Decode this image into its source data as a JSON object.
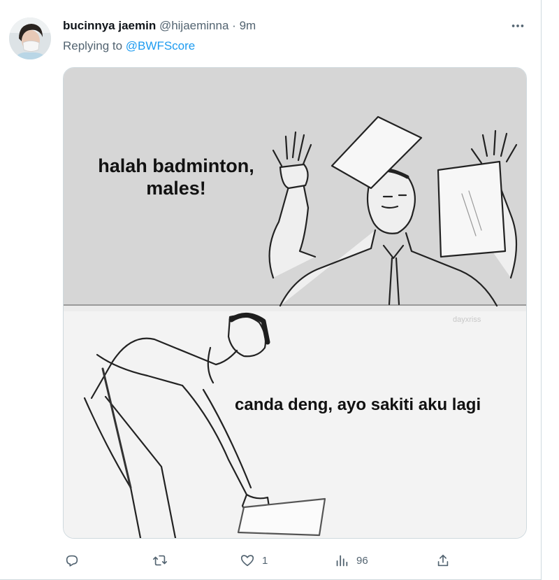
{
  "tweet": {
    "display_name": "bucinnya jaemin",
    "handle": "@hijaeminna",
    "separator": "·",
    "time": "9m",
    "replying_label": "Replying to",
    "replying_to": "@BWFScore"
  },
  "meme": {
    "top_caption": "halah badminton, males!",
    "bottom_caption": "canda deng, ayo sakiti aku lagi",
    "watermark": "dayxriss"
  },
  "actions": {
    "reply_count": "",
    "retweet_count": "",
    "like_count": "1",
    "views_count": "96"
  },
  "icons": {
    "more": "more-icon",
    "reply": "reply-icon",
    "retweet": "retweet-icon",
    "like": "heart-icon",
    "views": "views-icon",
    "share": "share-icon"
  },
  "colors": {
    "link": "#1d9bf0",
    "secondary_text": "#536471",
    "border": "#cfd9de"
  }
}
